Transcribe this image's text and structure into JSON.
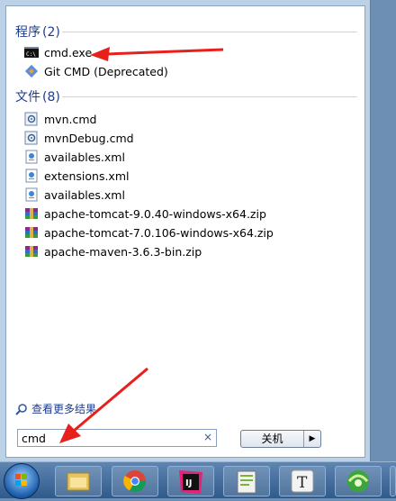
{
  "programs": {
    "header": "程序",
    "count": "(2)",
    "items": [
      {
        "label": "cmd.exe",
        "icon": "cmd-icon"
      },
      {
        "label": "Git CMD (Deprecated)",
        "icon": "git-icon"
      }
    ]
  },
  "files": {
    "header": "文件",
    "count": "(8)",
    "items": [
      {
        "label": "mvn.cmd",
        "icon": "script-file-icon"
      },
      {
        "label": "mvnDebug.cmd",
        "icon": "script-file-icon"
      },
      {
        "label": "availables.xml",
        "icon": "xml-file-icon"
      },
      {
        "label": "extensions.xml",
        "icon": "xml-file-icon"
      },
      {
        "label": "availables.xml",
        "icon": "xml-file-icon"
      },
      {
        "label": "apache-tomcat-9.0.40-windows-x64.zip",
        "icon": "archive-icon"
      },
      {
        "label": "apache-tomcat-7.0.106-windows-x64.zip",
        "icon": "archive-icon"
      },
      {
        "label": "apache-maven-3.6.3-bin.zip",
        "icon": "archive-icon"
      }
    ]
  },
  "see_more": "查看更多结果",
  "search": {
    "value": "cmd",
    "clear": "×"
  },
  "shutdown": {
    "label": "关机",
    "arrow": "▶"
  },
  "colors": {
    "header": "#1e3c8c",
    "annotation": "#e8201c"
  }
}
